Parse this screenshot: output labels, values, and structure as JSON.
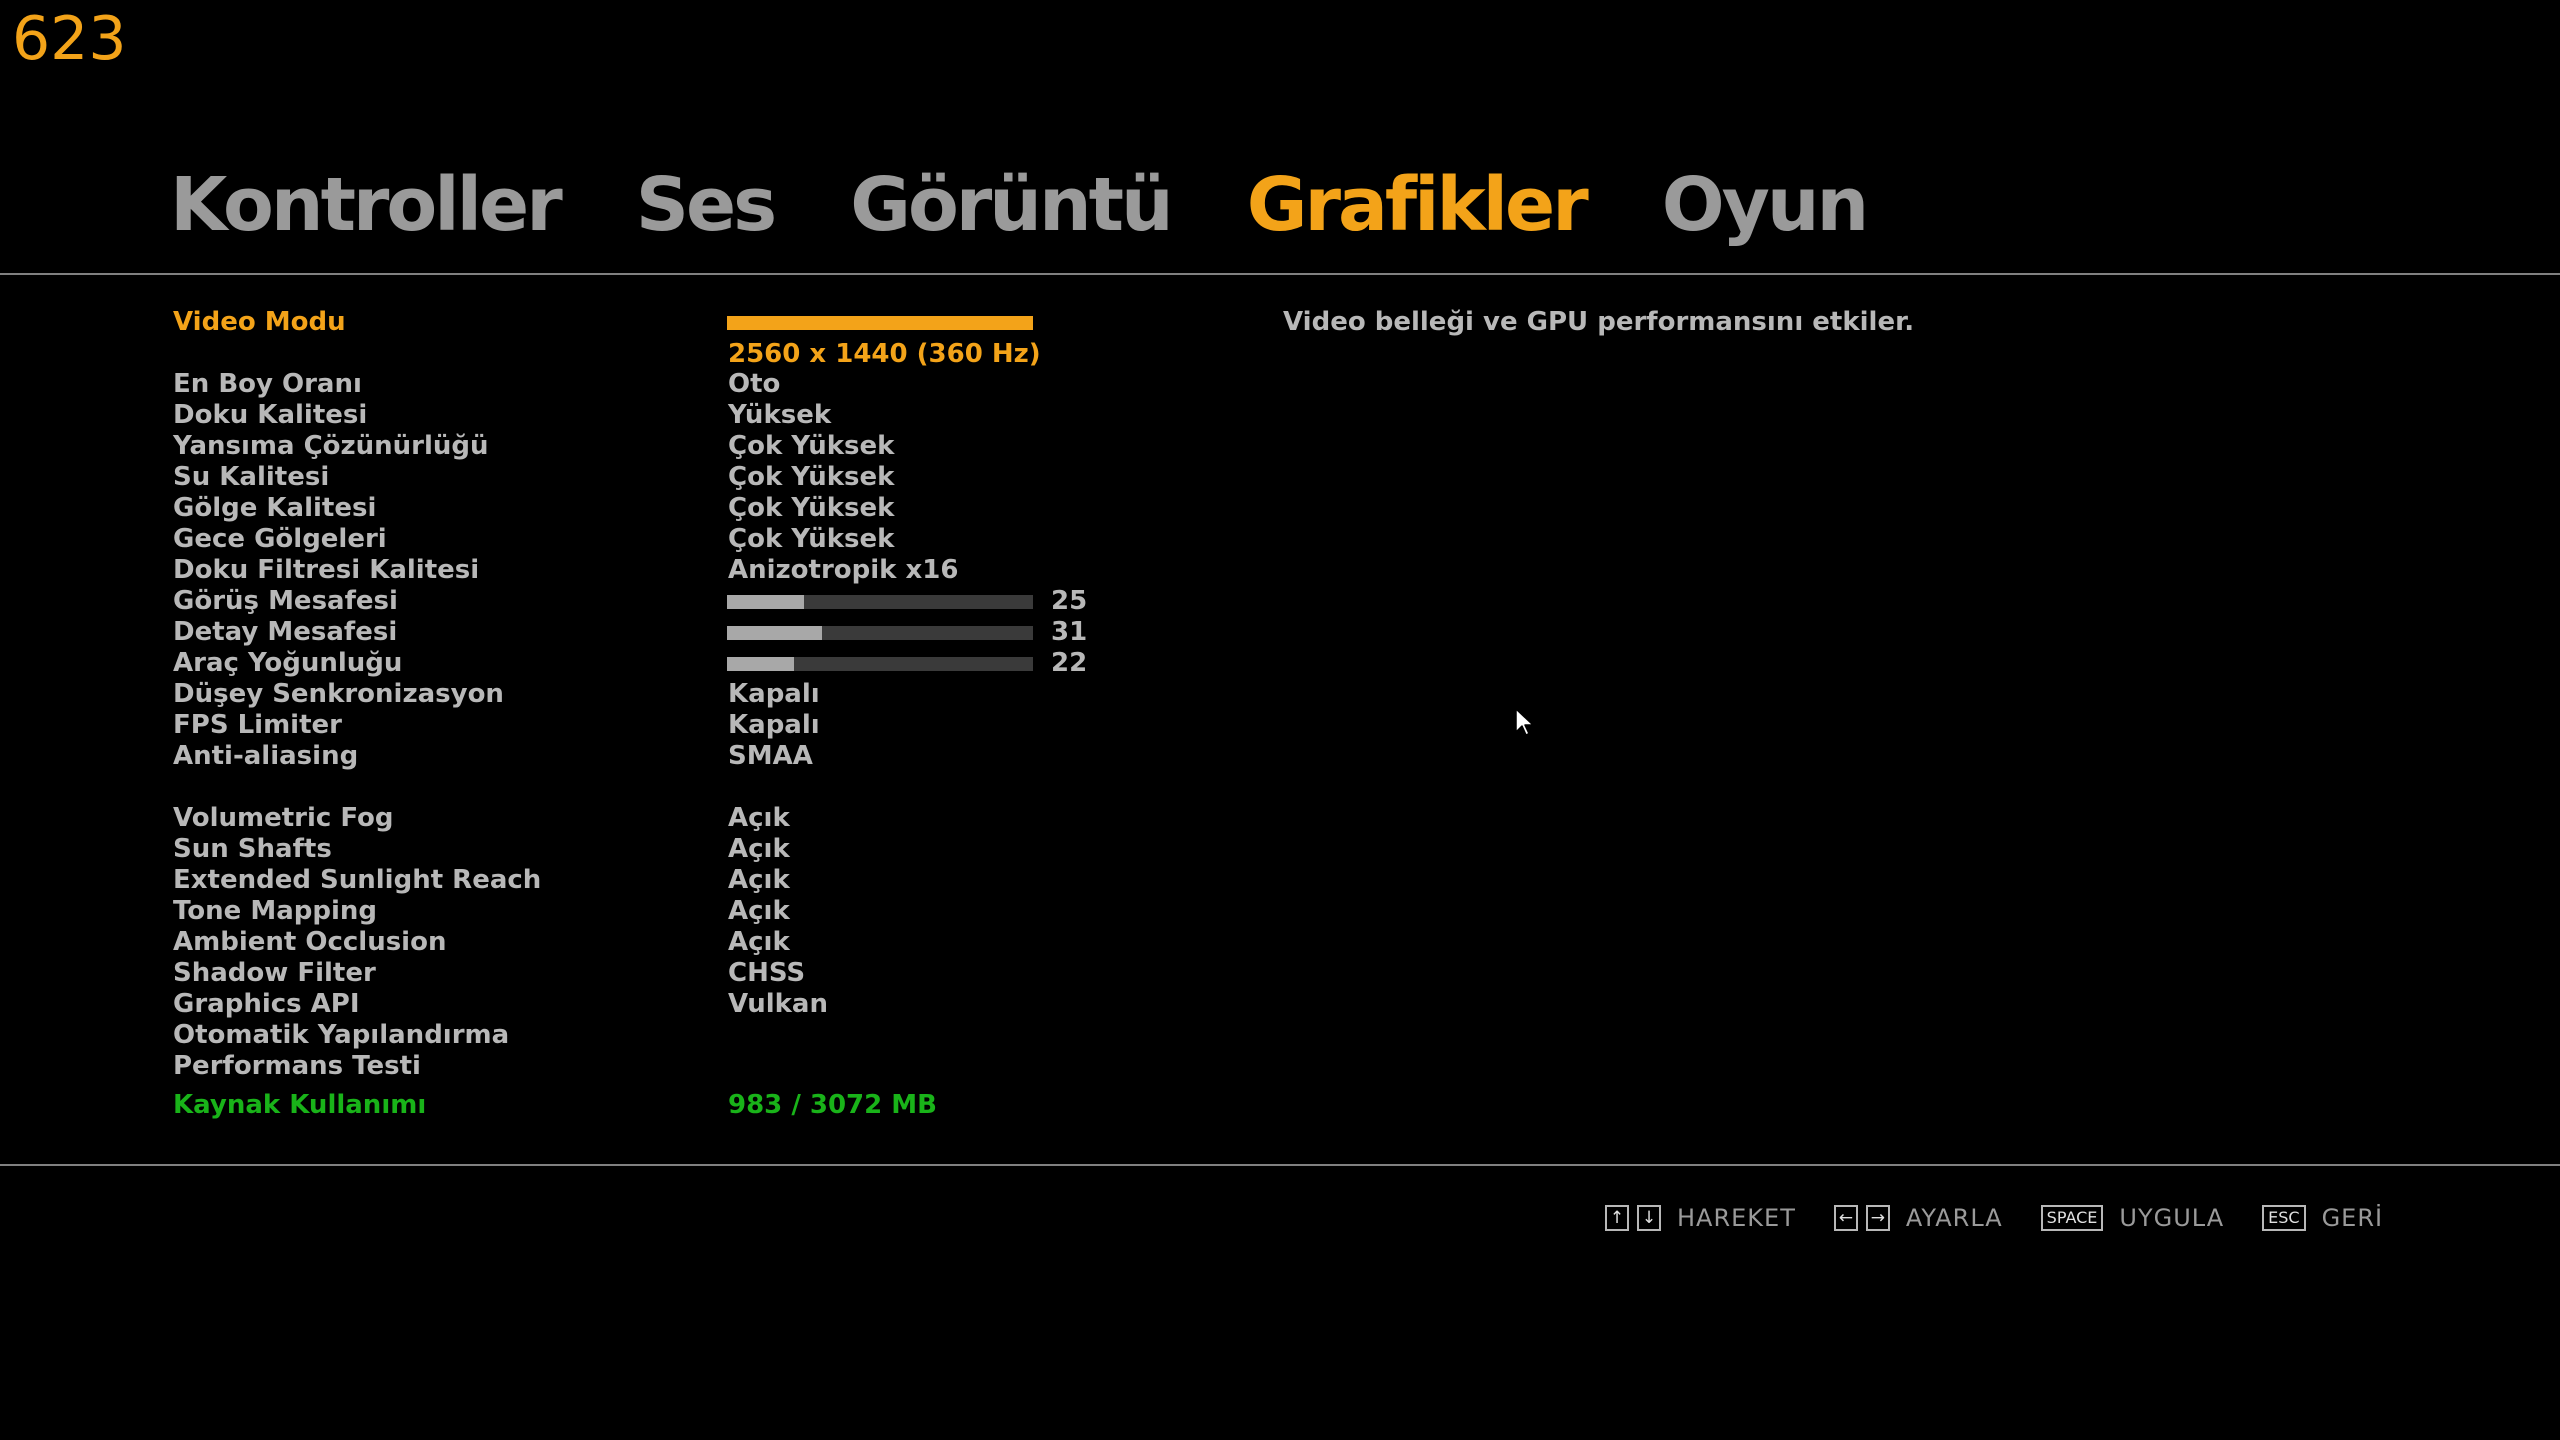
{
  "fps_counter": "623",
  "tabs": [
    {
      "label": "Kontroller",
      "active": false
    },
    {
      "label": "Ses",
      "active": false
    },
    {
      "label": "Görüntü",
      "active": false
    },
    {
      "label": "Grafikler",
      "active": true
    },
    {
      "label": "Oyun",
      "active": false
    }
  ],
  "settings": {
    "video_mode": {
      "label": "Video Modu",
      "value": "2560 x 1440 (360 Hz)"
    },
    "aspect_ratio": {
      "label": "En Boy Oranı",
      "value": "Oto"
    },
    "texture_quality": {
      "label": "Doku Kalitesi",
      "value": "Yüksek"
    },
    "reflection_resolution": {
      "label": "Yansıma Çözünürlüğü",
      "value": "Çok Yüksek"
    },
    "water_quality": {
      "label": "Su Kalitesi",
      "value": "Çok Yüksek"
    },
    "shadow_quality": {
      "label": "Gölge Kalitesi",
      "value": "Çok Yüksek"
    },
    "night_shadows": {
      "label": "Gece Gölgeleri",
      "value": "Çok Yüksek"
    },
    "texture_filter_quality": {
      "label": "Doku Filtresi Kalitesi",
      "value": "Anizotropik x16"
    },
    "view_distance": {
      "label": "Görüş Mesafesi",
      "value": 25,
      "display": "25",
      "fraction": 0.25
    },
    "detail_distance": {
      "label": "Detay Mesafesi",
      "value": 31,
      "display": "31",
      "fraction": 0.31
    },
    "vehicle_density": {
      "label": "Araç Yoğunluğu",
      "value": 22,
      "display": "22",
      "fraction": 0.22
    },
    "vsync": {
      "label": "Düşey Senkronizasyon",
      "value": "Kapalı"
    },
    "fps_limiter": {
      "label": "FPS Limiter",
      "value": "Kapalı"
    },
    "anti_aliasing": {
      "label": "Anti-aliasing",
      "value": "SMAA"
    },
    "volumetric_fog": {
      "label": "Volumetric Fog",
      "value": "Açık"
    },
    "sun_shafts": {
      "label": "Sun Shafts",
      "value": "Açık"
    },
    "extended_sunlight_reach": {
      "label": "Extended Sunlight Reach",
      "value": "Açık"
    },
    "tone_mapping": {
      "label": "Tone Mapping",
      "value": "Açık"
    },
    "ambient_occlusion": {
      "label": "Ambient Occlusion",
      "value": "Açık"
    },
    "shadow_filter": {
      "label": "Shadow Filter",
      "value": "CHSS"
    },
    "graphics_api": {
      "label": "Graphics API",
      "value": "Vulkan"
    },
    "auto_config": {
      "label": "Otomatik Yapılandırma"
    },
    "performance_test": {
      "label": "Performans Testi"
    },
    "resource_usage": {
      "label": "Kaynak Kullanımı",
      "value": "983 / 3072 MB"
    }
  },
  "description": "Video belleği ve GPU performansını etkiler.",
  "footer": {
    "move": {
      "keys": [
        "↑",
        "↓"
      ],
      "label": "HAREKET"
    },
    "adjust": {
      "keys": [
        "←",
        "→"
      ],
      "label": "AYARLA"
    },
    "apply": {
      "key": "SPACE",
      "label": "UYGULA"
    },
    "back": {
      "key": "ESC",
      "label": "GERİ"
    }
  },
  "colors": {
    "accent": "#f3a319",
    "text": "#b8b8b8",
    "tab_inactive": "#9a9a9a",
    "resource_green": "#19b319",
    "background": "#000000"
  }
}
